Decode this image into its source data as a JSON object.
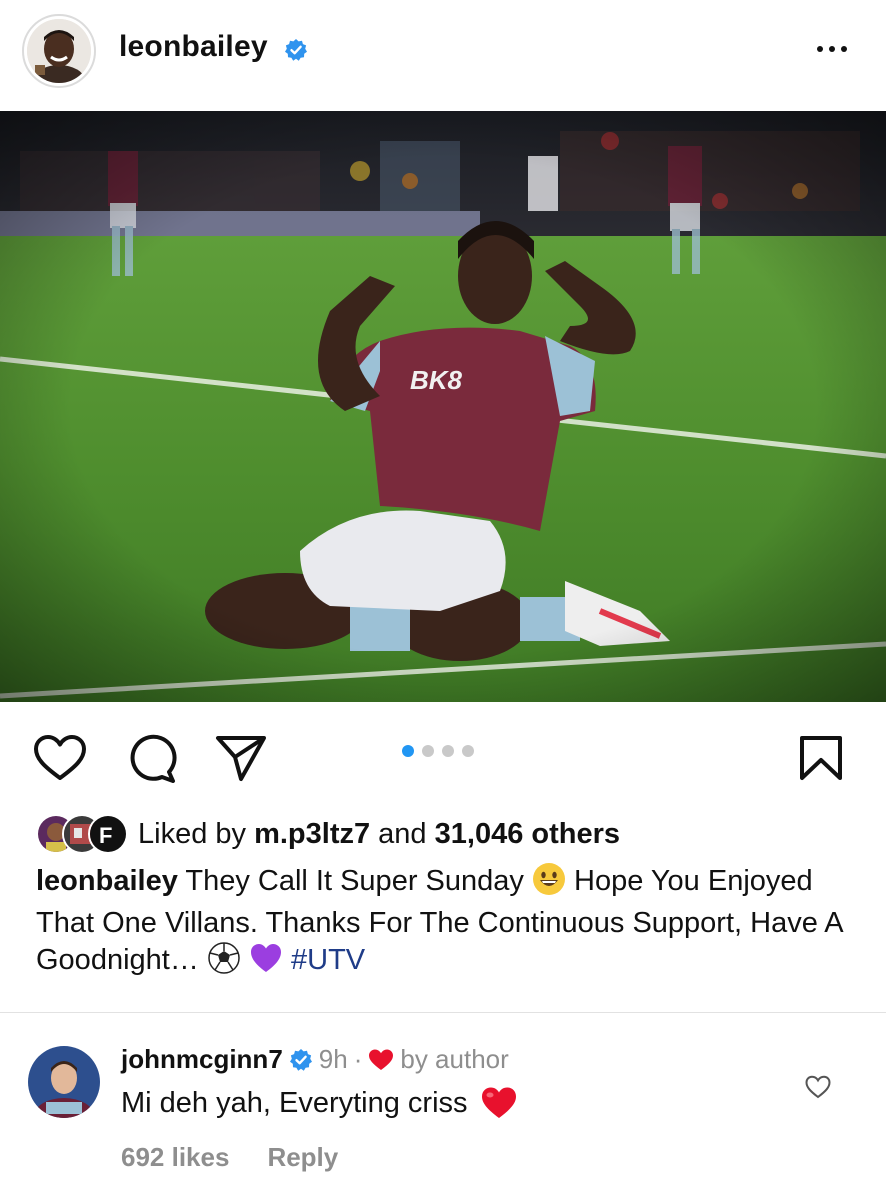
{
  "post": {
    "username": "leonbailey",
    "verified": true,
    "more_icon": "more-horizontal-icon"
  },
  "carousel": {
    "slide_count": 4,
    "active_index": 0,
    "accent": "#2196f3"
  },
  "actions": {
    "like_icon": "heart-outline-icon",
    "comment_icon": "comment-bubble-icon",
    "share_icon": "paper-plane-icon",
    "save_icon": "bookmark-icon"
  },
  "likes": {
    "prefix": "Liked by",
    "liked_by_user": "m.p3ltz7",
    "conjunction": "and",
    "others": "31,046 others"
  },
  "caption": {
    "username": "leonbailey",
    "text_part1": "They Call It Super Sunday",
    "text_part2": "Hope You Enjoyed That One Villans. Thanks For The Continuous Support, Have A Goodnight…",
    "hashtag": "#UTV",
    "hashtag_color": "#1f3c88"
  },
  "comment": {
    "username": "johnmcginn7",
    "verified": true,
    "time": "9h",
    "separator": "·",
    "liked_by_author": "by author",
    "text": "Mi deh yah, Everyting criss",
    "likes": "692 likes",
    "reply": "Reply",
    "heart_color": "#e8112d"
  }
}
